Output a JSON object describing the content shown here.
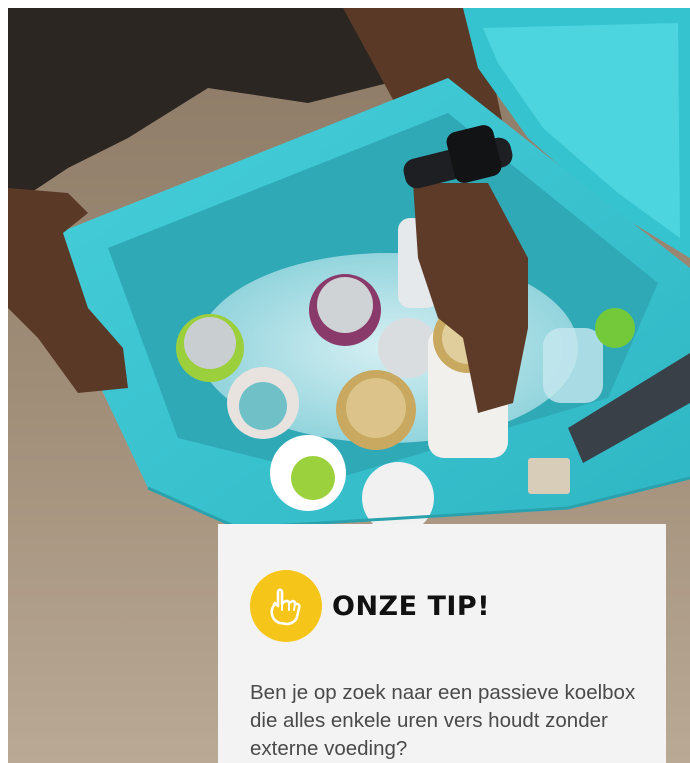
{
  "photo": {
    "subject": "turquoise cooler box with drinks cans and ice on sand"
  },
  "tip": {
    "icon": "pointing-hand-icon",
    "title": "ONZE TIP!",
    "text": "Ben je op zoek naar een passieve koelbox die alles enkele uren vers houdt zonder externe voeding?"
  },
  "colors": {
    "card_background": "#f3f3f3",
    "icon_background": "#f6c51a",
    "cooler": "#3cc8d3",
    "title": "#111111",
    "body_text": "#4a4a4a"
  }
}
